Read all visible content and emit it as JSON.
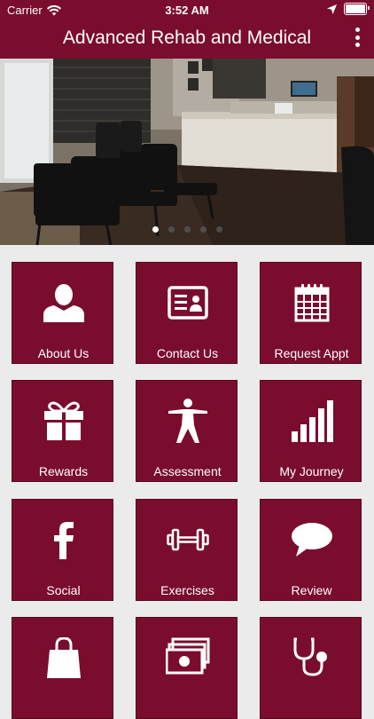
{
  "status": {
    "carrier": "Carrier",
    "time": "3:52 AM"
  },
  "header": {
    "title": "Advanced Rehab and Medical"
  },
  "carousel": {
    "pages": 5,
    "active": 1
  },
  "colors": {
    "brand": "#7a0d2e",
    "background": "#ebebeb"
  },
  "tiles": [
    {
      "label": "About Us",
      "icon": "person-icon"
    },
    {
      "label": "Contact Us",
      "icon": "contact-card-icon"
    },
    {
      "label": "Request Appt",
      "icon": "calendar-icon"
    },
    {
      "label": "Rewards",
      "icon": "gift-icon"
    },
    {
      "label": "Assessment",
      "icon": "body-figure-icon"
    },
    {
      "label": "My Journey",
      "icon": "bar-chart-icon"
    },
    {
      "label": "Social",
      "icon": "facebook-icon"
    },
    {
      "label": "Exercises",
      "icon": "dumbbell-icon"
    },
    {
      "label": "Review",
      "icon": "speech-bubble-icon"
    },
    {
      "label": "",
      "icon": "shopping-bag-icon"
    },
    {
      "label": "",
      "icon": "money-stack-icon"
    },
    {
      "label": "",
      "icon": "stethoscope-icon"
    }
  ]
}
